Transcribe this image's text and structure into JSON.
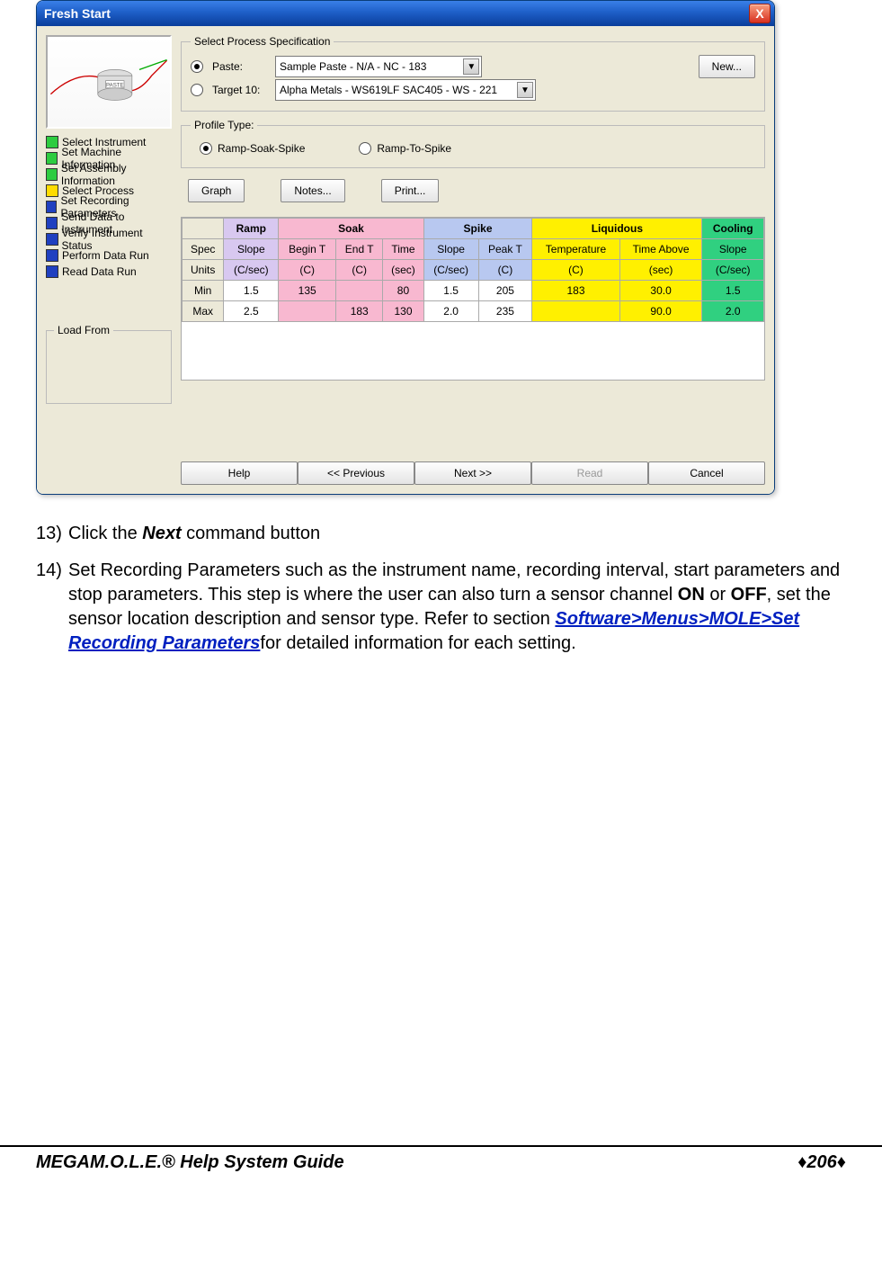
{
  "window": {
    "title": "Fresh Start",
    "close_label": "X"
  },
  "steps": [
    {
      "label": "Select Instrument",
      "state": "done"
    },
    {
      "label": "Set Machine Information",
      "state": "done"
    },
    {
      "label": "Set Assembly Information",
      "state": "done"
    },
    {
      "label": "Select Process",
      "state": "active"
    },
    {
      "label": "Set Recording Parameters",
      "state": "pending"
    },
    {
      "label": "Send Data to Instrument",
      "state": "pending"
    },
    {
      "label": "Verify Instrument Status",
      "state": "pending"
    },
    {
      "label": "Perform Data Run",
      "state": "pending"
    },
    {
      "label": "Read Data Run",
      "state": "pending"
    }
  ],
  "loadfrom_legend": "Load From",
  "spec_fieldset": {
    "legend": "Select Process Specification",
    "paste_label": "Paste:",
    "paste_selected": true,
    "paste_value": "Sample Paste - N/A - NC - 183",
    "target_label": "Target 10:",
    "target_selected": false,
    "target_value": "Alpha Metals - WS619LF SAC405 - WS - 221",
    "new_btn": "New..."
  },
  "profile": {
    "legend": "Profile Type:",
    "opt1": "Ramp-Soak-Spike",
    "opt2": "Ramp-To-Spike"
  },
  "action_buttons": {
    "graph": "Graph",
    "notes": "Notes...",
    "print": "Print..."
  },
  "table": {
    "phases": [
      "",
      "Ramp",
      "Soak",
      "Spike",
      "Liquidous",
      "Cooling"
    ],
    "rows": {
      "spec": {
        "label": "Spec",
        "ramp": "Slope",
        "soak1": "Begin T",
        "soak2": "End T",
        "soak3": "Time",
        "spike1": "Slope",
        "spike2": "Peak T",
        "liq1": "Temperature",
        "liq2": "Time Above",
        "cool": "Slope"
      },
      "units": {
        "label": "Units",
        "ramp": "(C/sec)",
        "soak1": "(C)",
        "soak2": "(C)",
        "soak3": "(sec)",
        "spike1": "(C/sec)",
        "spike2": "(C)",
        "liq1": "(C)",
        "liq2": "(sec)",
        "cool": "(C/sec)"
      },
      "min": {
        "label": "Min",
        "ramp": "1.5",
        "soak1": "135",
        "soak2": "",
        "soak3": "80",
        "spike1": "1.5",
        "spike2": "205",
        "liq1": "183",
        "liq2": "30.0",
        "cool": "1.5"
      },
      "max": {
        "label": "Max",
        "ramp": "2.5",
        "soak1": "",
        "soak2": "183",
        "soak3": "130",
        "spike1": "2.0",
        "spike2": "235",
        "liq1": "",
        "liq2": "90.0",
        "cool": "2.0"
      }
    }
  },
  "wizard_buttons": {
    "help": "Help",
    "prev": "<< Previous",
    "next": "Next >>",
    "read": "Read",
    "cancel": "Cancel"
  },
  "doc": {
    "item13_num": "13)",
    "item13_a": "Click the ",
    "item13_b": "Next",
    "item13_c": " command button",
    "item14_num": "14)",
    "item14_a": "Set Recording Parameters such as the instrument name, recording interval, start parameters and stop parameters. This step is where the user can also turn a sensor channel ",
    "item14_b": "ON",
    "item14_c": " or ",
    "item14_d": "OFF",
    "item14_e": ", set the sensor location description and sensor type. Refer to section  ",
    "item14_link": "Software>Menus>MOLE>Set Recording Parameters",
    "item14_f": "for detailed information for each setting."
  },
  "footer": {
    "left_mega": "MEGA",
    "left_rest": "M.O.L.E.® Help System Guide",
    "diamond": "♦",
    "page": "206"
  }
}
